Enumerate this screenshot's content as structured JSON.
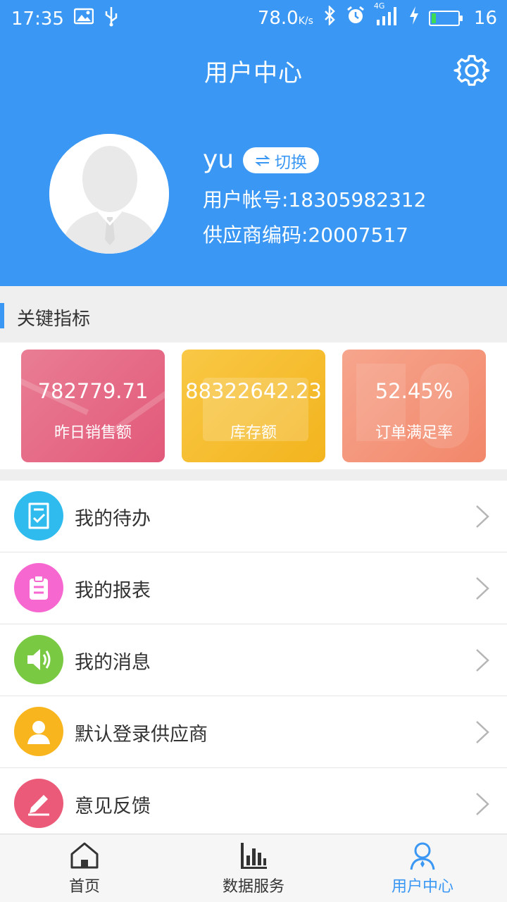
{
  "status_bar": {
    "time": "17:35",
    "speed": "78.0",
    "speed_unit": "K/s",
    "network": "4G",
    "battery_level": "16"
  },
  "header": {
    "title": "用户中心",
    "username": "yu",
    "switch_label": "切换",
    "account_label": "用户帐号:18305982312",
    "supplier_code_label": "供应商编码:20007517"
  },
  "metrics": {
    "section_title": "关键指标",
    "cards": [
      {
        "value": "782779.71",
        "caption": "昨日销售额"
      },
      {
        "value": "88322642.23",
        "caption": "库存额"
      },
      {
        "value": "52.45%",
        "caption": "订单满足率"
      }
    ]
  },
  "menu": {
    "items": [
      {
        "label": "我的待办",
        "icon": "todo-check-icon",
        "color": "#2fbbee"
      },
      {
        "label": "我的报表",
        "icon": "clipboard-icon",
        "color": "#f767d0"
      },
      {
        "label": "我的消息",
        "icon": "speaker-icon",
        "color": "#7ac943"
      },
      {
        "label": "默认登录供应商",
        "icon": "person-icon",
        "color": "#f9b51e"
      },
      {
        "label": "意见反馈",
        "icon": "pencil-icon",
        "color": "#eb5a78"
      }
    ]
  },
  "tabbar": {
    "tabs": [
      {
        "label": "首页",
        "icon": "home-icon"
      },
      {
        "label": "数据服务",
        "icon": "bar-chart-icon"
      },
      {
        "label": "用户中心",
        "icon": "user-center-icon",
        "active": true
      }
    ]
  },
  "colors": {
    "primary": "#3a97f3",
    "card_sales": "#e2597a",
    "card_inventory": "#f3b41e",
    "card_rate": "#f2876a"
  }
}
